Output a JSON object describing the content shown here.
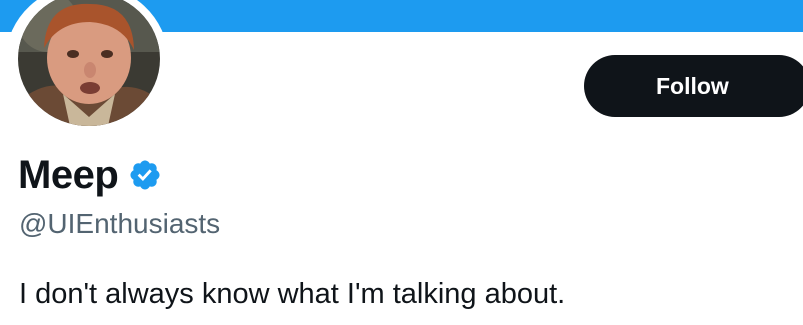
{
  "profile": {
    "display_name": "Meep",
    "handle": "@UIEnthusiasts",
    "bio": "I don't always know what I'm talking about.",
    "verified": true,
    "avatar": "profile-photo"
  },
  "actions": {
    "follow_label": "Follow"
  },
  "colors": {
    "banner": "#1d9bf0",
    "verified_badge": "#1d9bf0",
    "follow_button_bg": "#0f1419",
    "handle_text": "#536471"
  },
  "icons": {
    "verified": "verified-badge-icon"
  }
}
